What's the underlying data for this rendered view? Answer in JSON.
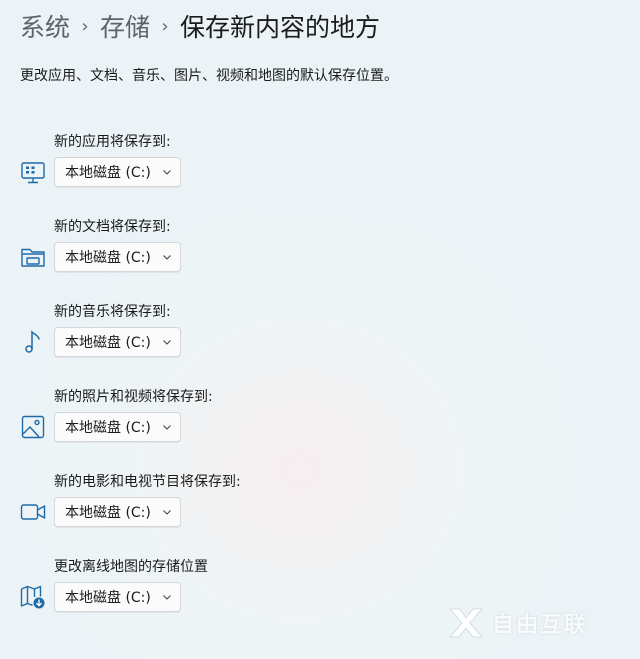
{
  "breadcrumb": {
    "items": [
      "系统",
      "存储",
      "保存新内容的地方"
    ],
    "separator": "›"
  },
  "description": "更改应用、文档、音乐、图片、视频和地图的默认保存位置。",
  "rows": [
    {
      "label": "新的应用将保存到:",
      "value": "本地磁盘 (C:)",
      "icon": "apps-monitor-icon"
    },
    {
      "label": "新的文档将保存到:",
      "value": "本地磁盘 (C:)",
      "icon": "folder-icon"
    },
    {
      "label": "新的音乐将保存到:",
      "value": "本地磁盘 (C:)",
      "icon": "music-note-icon"
    },
    {
      "label": "新的照片和视频将保存到:",
      "value": "本地磁盘 (C:)",
      "icon": "image-icon"
    },
    {
      "label": "新的电影和电视节目将保存到:",
      "value": "本地磁盘 (C:)",
      "icon": "video-camera-icon"
    },
    {
      "label": "更改离线地图的存储位置",
      "value": "本地磁盘 (C:)",
      "icon": "map-download-icon"
    }
  ],
  "watermark": {
    "text": "自由互联"
  },
  "colors": {
    "background": "#ebf3f6",
    "icon": "#1e6aa8",
    "text": "#1b1b1b",
    "muted": "#5f6368"
  }
}
